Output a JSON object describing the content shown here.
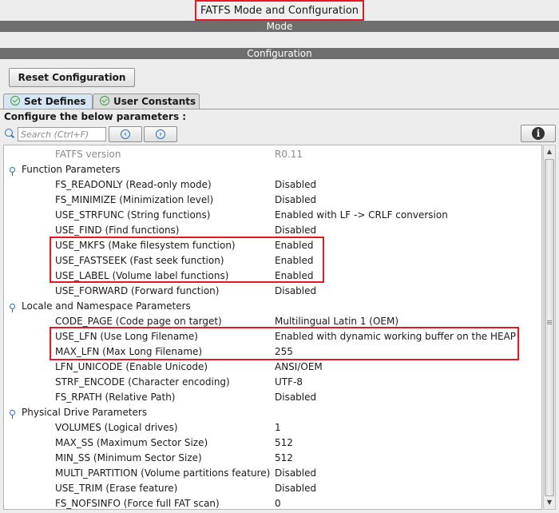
{
  "window": {
    "title": "FATFS Mode and Configuration"
  },
  "sections": {
    "mode": "Mode",
    "configuration": "Configuration"
  },
  "toolbar": {
    "reset_label": "Reset Configuration"
  },
  "tabs": [
    {
      "label": "Set Defines",
      "active": true
    },
    {
      "label": "User Constants",
      "active": false
    }
  ],
  "config": {
    "prompt": "Configure the below parameters :"
  },
  "search": {
    "placeholder": "Search (Ctrl+F)",
    "value": ""
  },
  "icons": {
    "search": "search-icon",
    "prev": "chevron-left-icon",
    "next": "chevron-right-icon",
    "info": "info-icon",
    "group": "pin-icon"
  },
  "colors": {
    "highlight": "#e01b24",
    "band": "#6e6e6e",
    "accent": "#2a6fb0"
  },
  "params": [
    {
      "label": "FATFS version",
      "value": "R0.11",
      "kind": "info"
    },
    {
      "label": "Function Parameters",
      "value": "",
      "kind": "group"
    },
    {
      "label": "FS_READONLY (Read-only mode)",
      "value": "Disabled",
      "kind": "item"
    },
    {
      "label": "FS_MINIMIZE (Minimization level)",
      "value": "Disabled",
      "kind": "item"
    },
    {
      "label": "USE_STRFUNC (String functions)",
      "value": "Enabled with LF -> CRLF conversion",
      "kind": "item"
    },
    {
      "label": "USE_FIND (Find functions)",
      "value": "Disabled",
      "kind": "item"
    },
    {
      "label": "USE_MKFS (Make filesystem function)",
      "value": "Enabled",
      "kind": "item"
    },
    {
      "label": "USE_FASTSEEK (Fast seek function)",
      "value": "Enabled",
      "kind": "item"
    },
    {
      "label": "USE_LABEL (Volume label functions)",
      "value": "Enabled",
      "kind": "item"
    },
    {
      "label": "USE_FORWARD (Forward function)",
      "value": "Disabled",
      "kind": "item"
    },
    {
      "label": "Locale and Namespace Parameters",
      "value": "",
      "kind": "group"
    },
    {
      "label": "CODE_PAGE (Code page on target)",
      "value": "Multilingual Latin 1 (OEM)",
      "kind": "item"
    },
    {
      "label": "USE_LFN (Use Long Filename)",
      "value": "Enabled with dynamic working buffer on the HEAP",
      "kind": "item"
    },
    {
      "label": "MAX_LFN (Max Long Filename)",
      "value": "255",
      "kind": "item"
    },
    {
      "label": "LFN_UNICODE (Enable Unicode)",
      "value": "ANSI/OEM",
      "kind": "item"
    },
    {
      "label": "STRF_ENCODE (Character encoding)",
      "value": "UTF-8",
      "kind": "item"
    },
    {
      "label": "FS_RPATH (Relative Path)",
      "value": "Disabled",
      "kind": "item"
    },
    {
      "label": "Physical Drive Parameters",
      "value": "",
      "kind": "group"
    },
    {
      "label": "VOLUMES (Logical drives)",
      "value": "1",
      "kind": "item"
    },
    {
      "label": "MAX_SS (Maximum Sector Size)",
      "value": "512",
      "kind": "item"
    },
    {
      "label": "MIN_SS (Minimum Sector Size)",
      "value": "512",
      "kind": "item"
    },
    {
      "label": "MULTI_PARTITION (Volume partitions feature)",
      "value": "Disabled",
      "kind": "item"
    },
    {
      "label": "USE_TRIM (Erase feature)",
      "value": "Disabled",
      "kind": "item"
    },
    {
      "label": "FS_NOFSINFO (Force full FAT scan)",
      "value": "0",
      "kind": "item"
    }
  ]
}
